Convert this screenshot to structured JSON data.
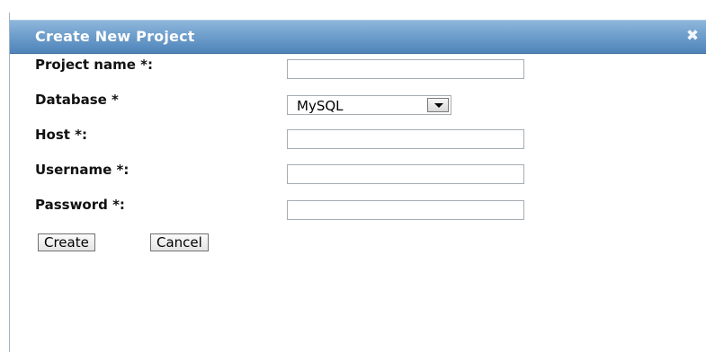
{
  "dialog": {
    "title": "Create New Project",
    "close_icon": "close-icon"
  },
  "form": {
    "project_name_label": "Project name *:",
    "database_label": "Database *",
    "database_value": "MySQL",
    "host_label": "Host *:",
    "username_label": "Username *:",
    "password_label": "Password *:"
  },
  "buttons": {
    "create": "Create",
    "cancel": "Cancel"
  }
}
